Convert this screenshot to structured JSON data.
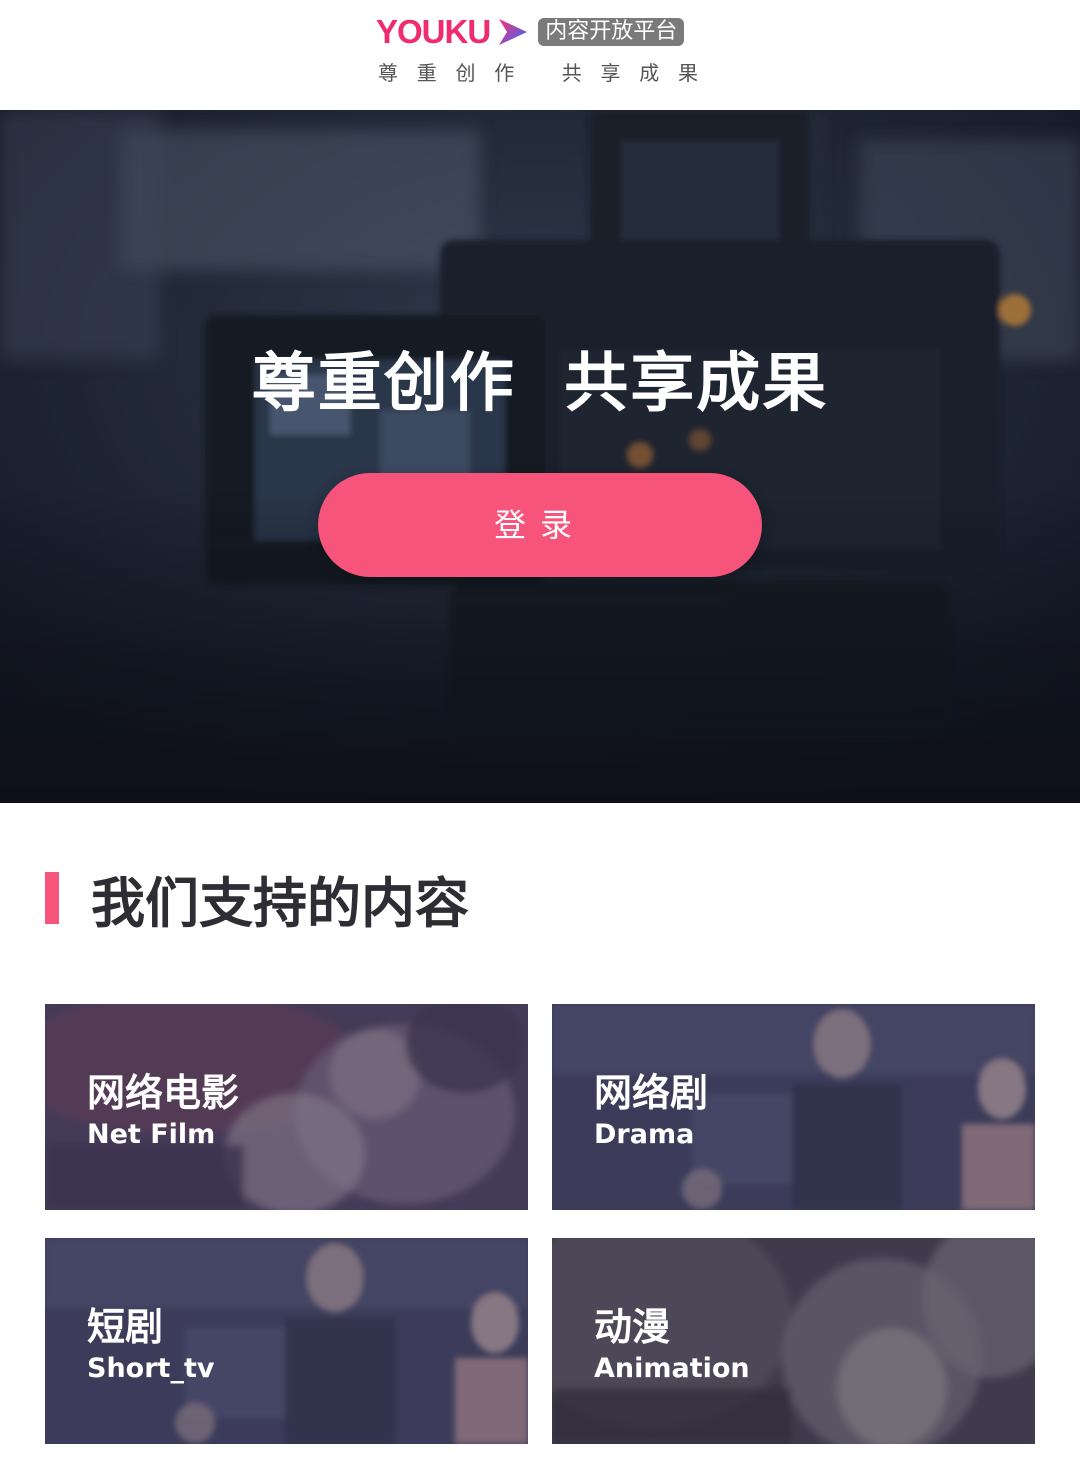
{
  "header": {
    "logo_text": "YOUKU",
    "platform_badge": "内容开放平台",
    "slogan_left": [
      "尊",
      "重",
      "创",
      "作"
    ],
    "slogan_right": [
      "共",
      "享",
      "成",
      "果"
    ]
  },
  "hero": {
    "title": "尊重创作  共享成果",
    "login_label": "登录"
  },
  "section": {
    "title": "我们支持的内容"
  },
  "cards": [
    {
      "title": "网络电影",
      "subtitle": "Net Film"
    },
    {
      "title": "网络剧",
      "subtitle": "Drama"
    },
    {
      "title": "短剧",
      "subtitle": "Short_tv"
    },
    {
      "title": "动漫",
      "subtitle": "Animation"
    }
  ],
  "colors": {
    "brand_pink": "#ef2c6f",
    "accent": "#f6547a",
    "hero_dark": "#1c2231"
  }
}
